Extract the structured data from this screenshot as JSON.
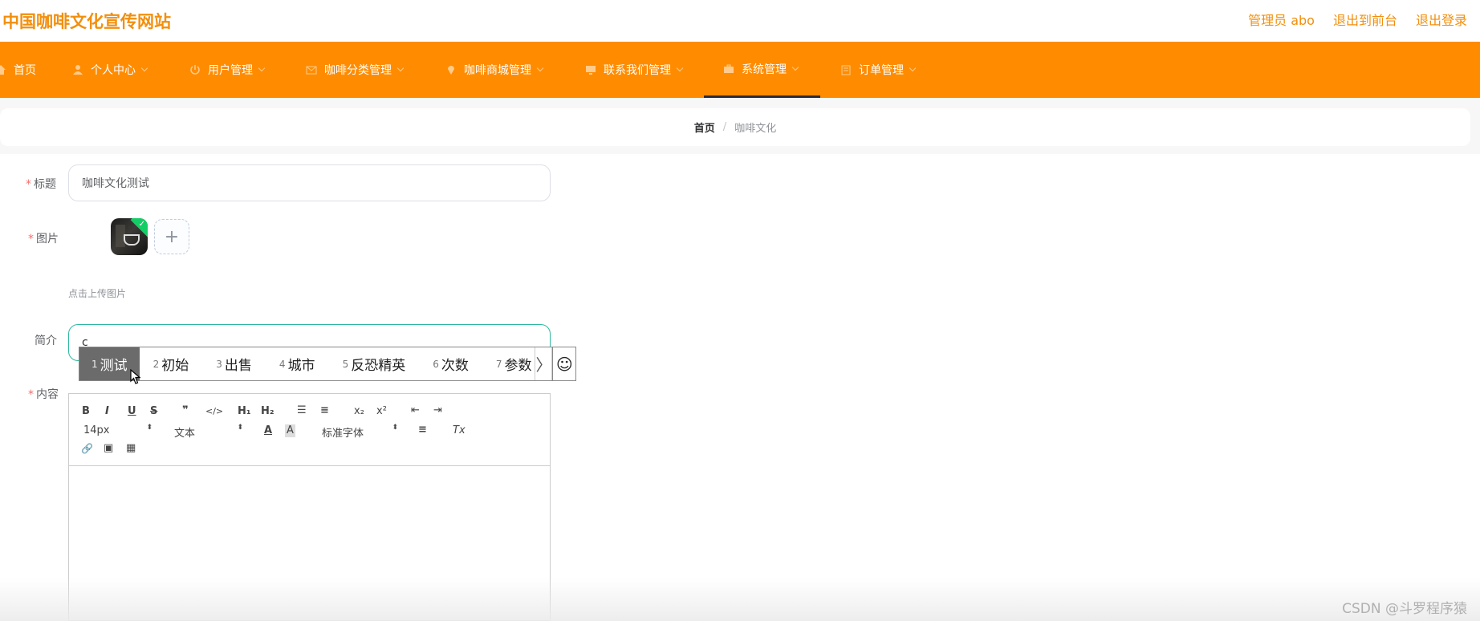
{
  "header": {
    "site_title": "中国咖啡文化宣传网站",
    "links": [
      "管理员 abo",
      "退出到前台",
      "退出登录"
    ]
  },
  "nav": {
    "items": [
      {
        "label": "首页",
        "icon": "home-icon"
      },
      {
        "label": "个人中心",
        "icon": "user-icon"
      },
      {
        "label": "用户管理",
        "icon": "power-icon"
      },
      {
        "label": "咖啡分类管理",
        "icon": "mail-icon"
      },
      {
        "label": "咖啡商城管理",
        "icon": "location-icon"
      },
      {
        "label": "联系我们管理",
        "icon": "monitor-icon"
      },
      {
        "label": "系统管理",
        "icon": "briefcase-icon"
      },
      {
        "label": "订单管理",
        "icon": "calendar-icon"
      }
    ],
    "active": "系统管理"
  },
  "breadcrumb": {
    "home": "首页",
    "separator": "/",
    "current": "咖啡文化"
  },
  "form": {
    "title_label": "标题",
    "title_value": "咖啡文化测试",
    "image_label": "图片",
    "image_plus": "+",
    "upload_tip": "点击上传图片",
    "intro_label": "简介",
    "intro_value": "c",
    "content_label": "内容",
    "required_mark": "*"
  },
  "ime": {
    "candidates": [
      {
        "num": "1",
        "text": "测试"
      },
      {
        "num": "2",
        "text": "初始"
      },
      {
        "num": "3",
        "text": "出售"
      },
      {
        "num": "4",
        "text": "城市"
      },
      {
        "num": "5",
        "text": "反恐精英"
      },
      {
        "num": "6",
        "text": "次数"
      },
      {
        "num": "7",
        "text": "参数"
      }
    ],
    "next_glyph": "〉",
    "emoji_glyph": "☺"
  },
  "editor": {
    "toolbar_row1": [
      "B",
      "I",
      "U",
      "S",
      "❞",
      "</>",
      "H₁",
      "H₂",
      "☰",
      "≡",
      "x₂",
      "x²",
      "⇤",
      "⇥"
    ],
    "font_size": "14px",
    "block_format": "文本",
    "font_family": "标准字体",
    "updown": "⬍",
    "color_glyph": "A",
    "bg_glyph": "A",
    "align_glyph": "≡",
    "clear_glyph": "Tx",
    "link_glyph": "🔗",
    "image_glyph": "▣",
    "video_glyph": "▦"
  },
  "watermark": "CSDN @斗罗程序猿",
  "colors": {
    "brand_orange": "#ff8c00",
    "title_orange": "#f28f0d",
    "required_red": "#f56c6c",
    "focus_teal": "#2eb8a0"
  }
}
